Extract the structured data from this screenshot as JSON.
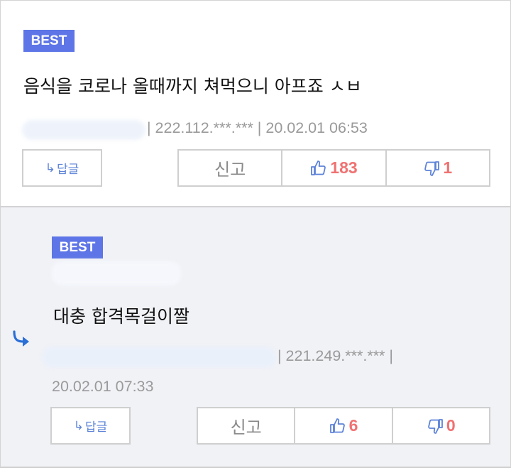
{
  "comments": [
    {
      "badge": "BEST",
      "text": "음식을 코로나 올때까지 쳐먹으니 아프죠 ㅅㅂ",
      "meta": "| 222.112.***.*** | 20.02.01 06:53",
      "reply_label": "답글",
      "report_label": "신고",
      "likes": "183",
      "dislikes": "1"
    },
    {
      "badge": "BEST",
      "text": "대충 합격목걸이짤",
      "meta_line1": "| 221.249.***.*** |",
      "meta_line2": "20.02.01 07:33",
      "reply_label": "답글",
      "report_label": "신고",
      "likes": "6",
      "dislikes": "0"
    }
  ],
  "colors": {
    "badge": "#5d75e6",
    "vote_count": "#f07272",
    "icon_blue": "#5d83d8",
    "reply_arrow": "#2a6fd6",
    "reply_bg": "#f1f2f6"
  },
  "icons": {
    "reply_button": "reply-arrow-icon",
    "like": "thumbs-up-icon",
    "dislike": "thumbs-down-icon",
    "nested_reply": "reply-indicator-icon"
  }
}
